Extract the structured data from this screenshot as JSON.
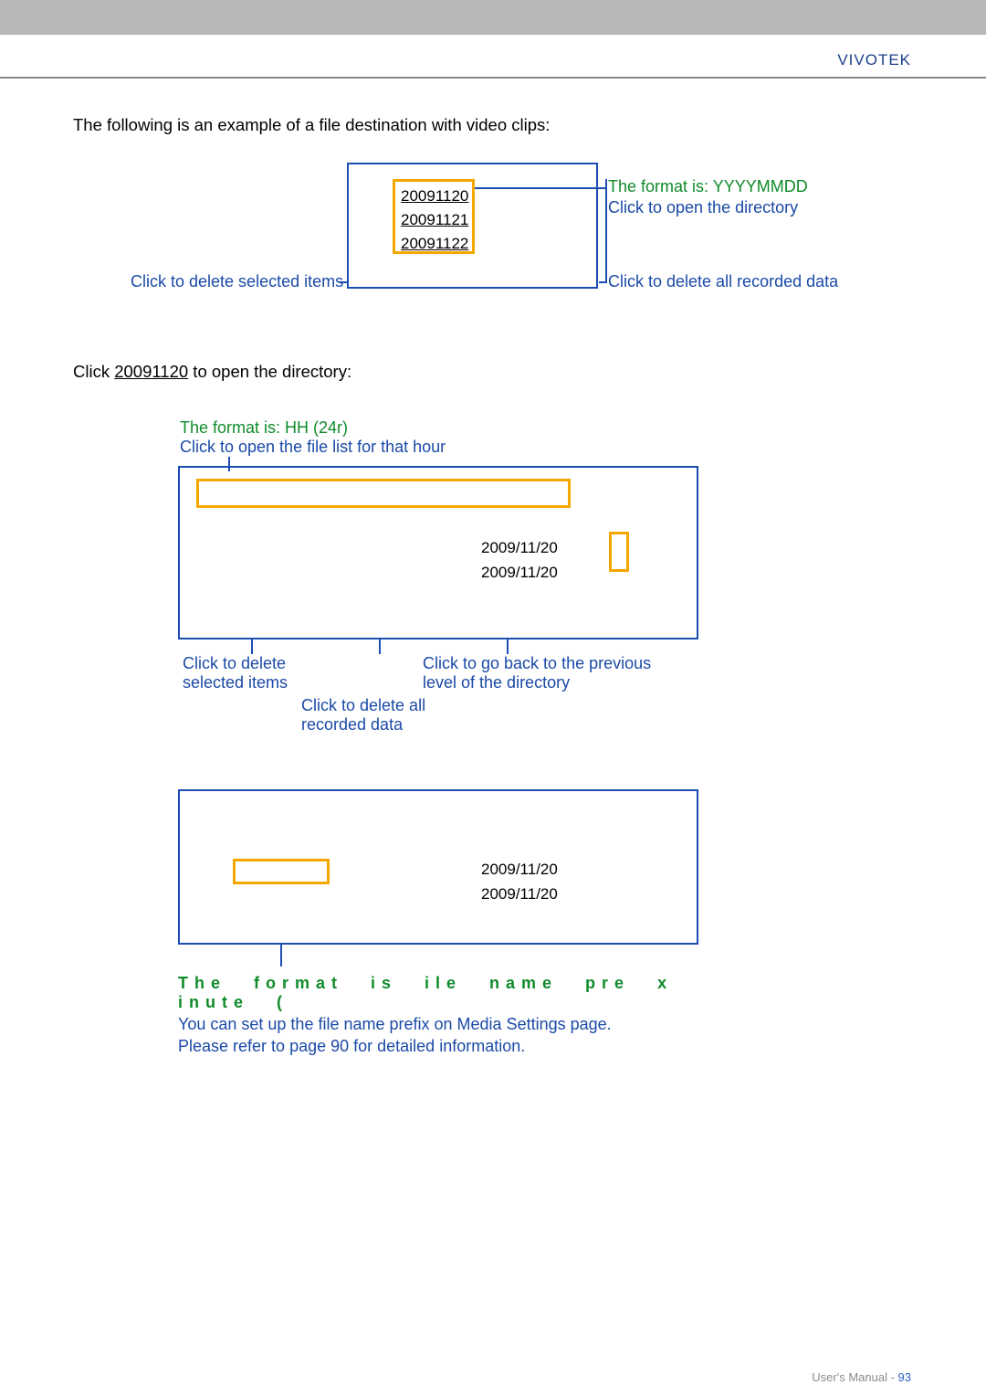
{
  "brand": "VIVOTEK",
  "intro": "The following is an example of a file destination with video clips:",
  "section1": {
    "links": [
      "20091120",
      "20091121",
      "20091122"
    ],
    "ann_format": "The format is: YYYYMMDD",
    "ann_open": "Click to open the directory",
    "ann_left": "Click to delete selected items",
    "ann_right": "Click to delete all recorded data"
  },
  "click_open": {
    "prefix": "Click ",
    "link": "20091120",
    "suffix": " to open the directory:"
  },
  "section2": {
    "ann_format": "The format is: HH (24r)",
    "ann_open": "Click to open the file list for that hour",
    "dates": [
      "2009/11/20",
      "2009/11/20"
    ],
    "under1": "Click to delete selected items",
    "under2": "Click to delete all recorded data",
    "under3": "Click to go back to the previous level of the directory"
  },
  "section3": {
    "dates": [
      "2009/11/20",
      "2009/11/20"
    ],
    "format_line": "The format is ile name pre x inute (",
    "blue_line1": "You can set up the file name prefix on Media Settings page.",
    "blue_line2": "Please refer to page 90 for detailed information."
  },
  "footer": {
    "label": "User's Manual - ",
    "page": "93"
  }
}
